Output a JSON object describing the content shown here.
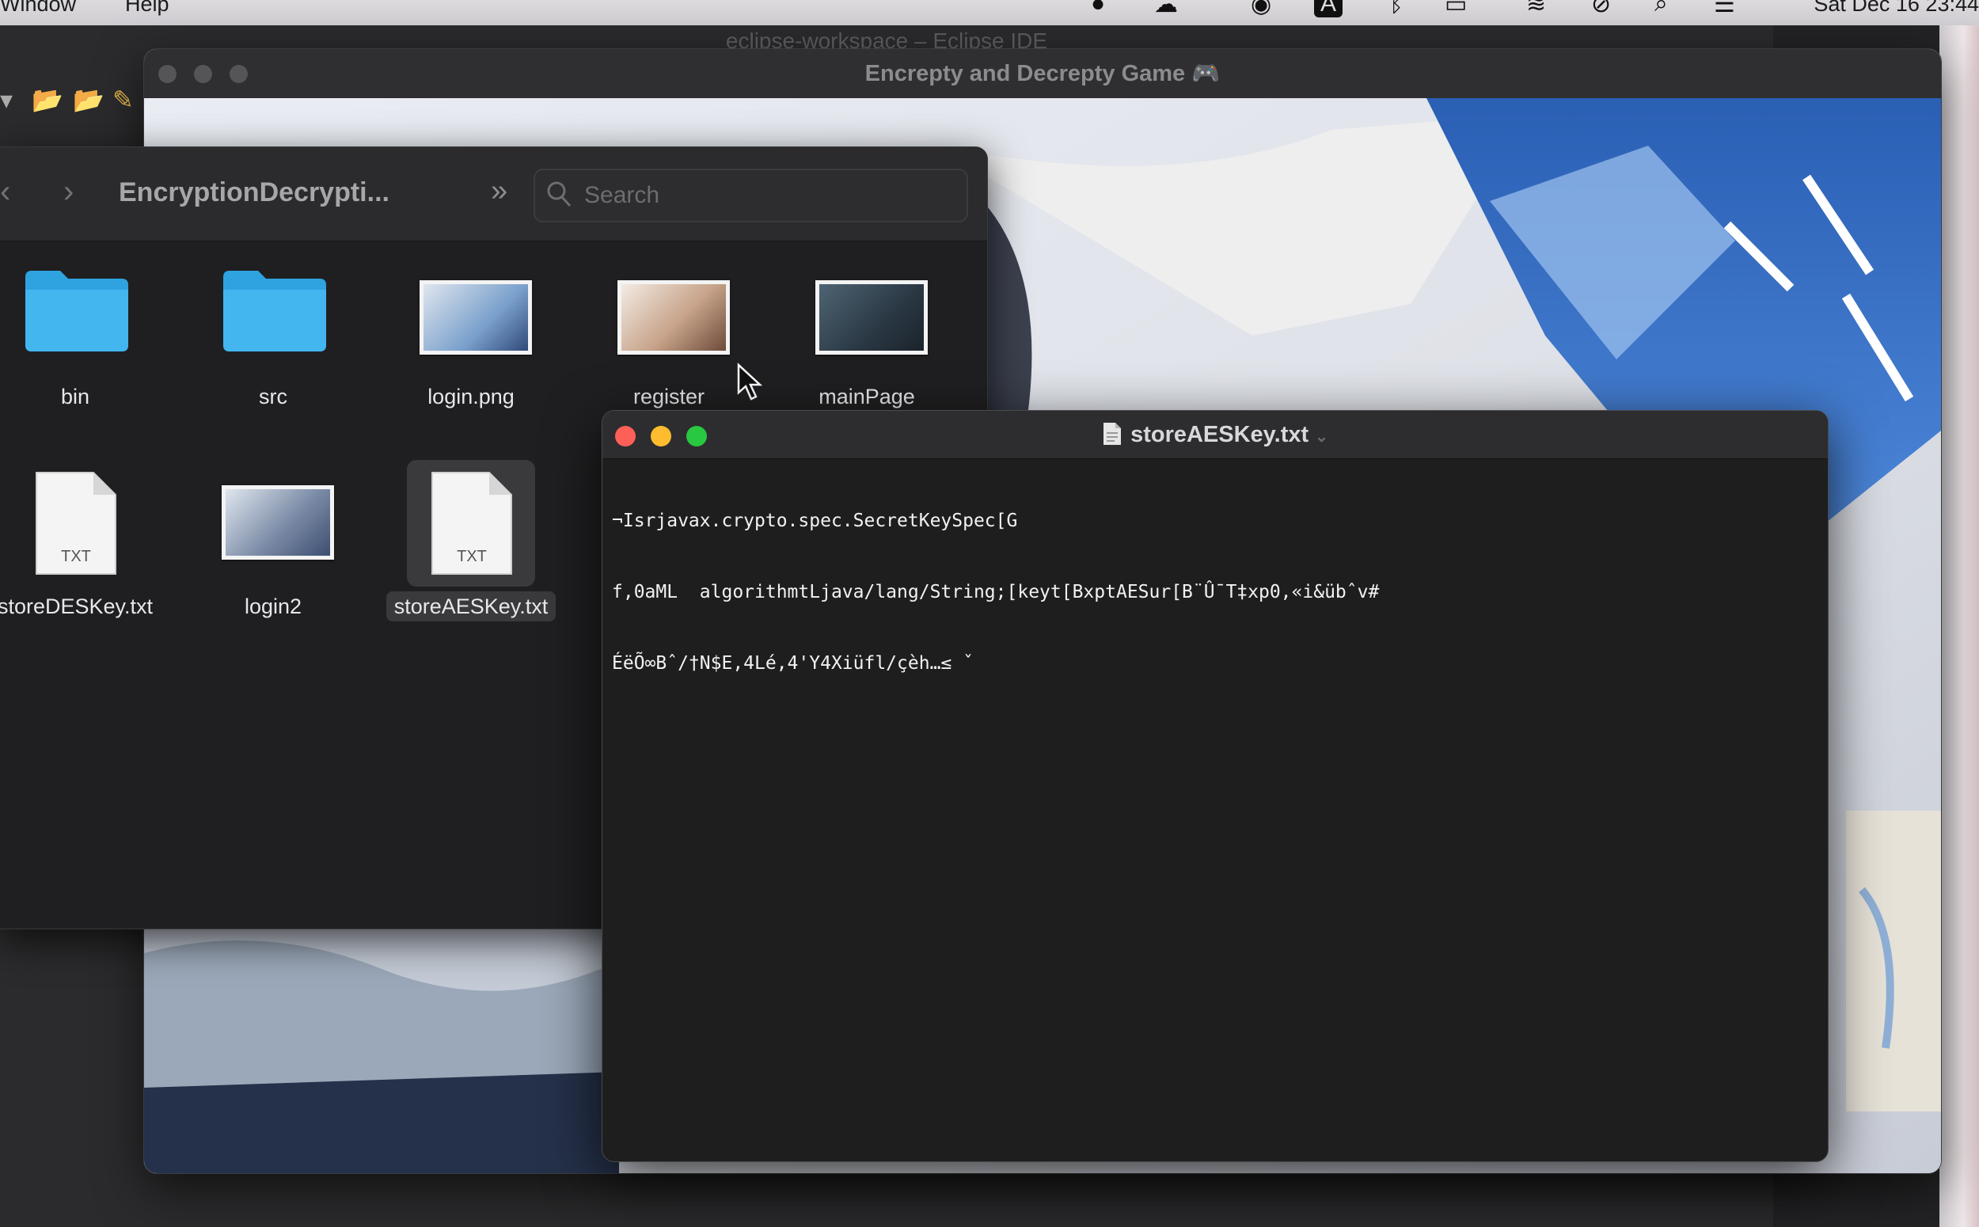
{
  "menubar": {
    "items": [
      "Window",
      "Help"
    ],
    "clock": "Sat Dec 16  23:44"
  },
  "eclipse": {
    "title": "eclipse-workspace – Eclipse IDE"
  },
  "game_window": {
    "title": "Encrepty and Decrepty Game 🎮"
  },
  "finder": {
    "path": "EncryptionDecrypti...",
    "search_placeholder": "Search",
    "items": [
      {
        "name": "bin",
        "type": "folder"
      },
      {
        "name": "src",
        "type": "folder"
      },
      {
        "name": "login.png",
        "type": "image"
      },
      {
        "name": "register",
        "type": "image"
      },
      {
        "name": "mainPage",
        "type": "image"
      },
      {
        "name": "storeDESKey.txt",
        "type": "txt",
        "badge": "TXT"
      },
      {
        "name": "login2",
        "type": "image"
      },
      {
        "name": "storeAESKey.txt",
        "type": "txt",
        "badge": "TXT",
        "selected": true
      }
    ]
  },
  "textedit": {
    "title": "storeAESKey.txt",
    "lines": [
      "¬Isrjavax.crypto.spec.SecretKeySpec[G",
      "f,0aML  algorithmtLjava/lang/String;[keyt[BxptAESur[B¨Û¯T‡xp0,«i&übˆv#",
      "ÉëÕ∞Bˆ/†N$E,4Lé,4'Y4Xiüfl/çèh…≤ ˇ"
    ]
  },
  "colors": {
    "folder_blue": "#3fb1ec",
    "close_red": "#fe5f57",
    "minimize_yellow": "#febc2e",
    "zoom_green": "#28c840"
  },
  "icons": [
    "chevron-left-icon",
    "chevron-right-icon",
    "double-chevron-icon",
    "search-icon",
    "folder-icon",
    "document-icon",
    "gamepad-icon"
  ]
}
